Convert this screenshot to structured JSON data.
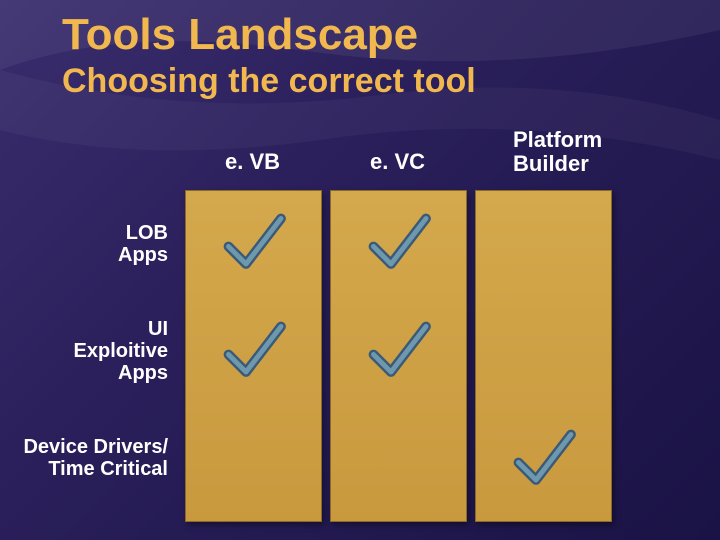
{
  "title": "Tools Landscape",
  "subtitle": "Choosing the correct tool",
  "columns": [
    "e. VB",
    "e. VC",
    "Platform\nBuilder"
  ],
  "rows": [
    "LOB\nApps",
    "UI\nExploitive\nApps",
    "Device Drivers/\nTime Critical"
  ],
  "chart_data": {
    "type": "table",
    "title": "Tools Landscape — Choosing the correct tool",
    "columns": [
      "e. VB",
      "e. VC",
      "Platform Builder"
    ],
    "rows": [
      "LOB Apps",
      "UI Exploitive Apps",
      "Device Drivers/ Time Critical"
    ],
    "values": [
      [
        true,
        true,
        false
      ],
      [
        true,
        true,
        false
      ],
      [
        false,
        false,
        true
      ]
    ]
  },
  "colors": {
    "accent": "#f0b84e",
    "column_fill": "#d0a446",
    "check_stroke": "#3b5a78",
    "check_fill": "#6e98ad"
  }
}
